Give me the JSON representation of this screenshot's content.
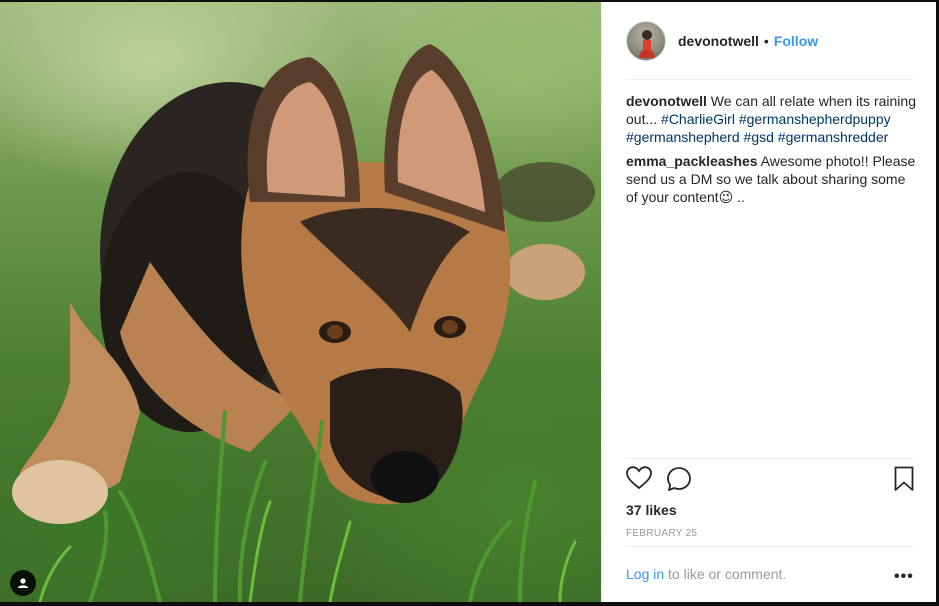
{
  "post": {
    "username": "devonotwell",
    "separator": "•",
    "follow_label": "Follow"
  },
  "comments": [
    {
      "user": "devonotwell",
      "text": "We can all relate when its raining out...",
      "tags": [
        "#CharlieGirl",
        "#germanshepherdpuppy",
        "#germanshepherd",
        "#gsd",
        "#germanshredder"
      ]
    },
    {
      "user": "emma_packleashes",
      "text": "Awesome photo!! Please send us a DM so we talk about sharing some of your content😉 .."
    }
  ],
  "likes_label": "37 likes",
  "date_label": "FEBRUARY 25",
  "footer": {
    "login_label": "Log in",
    "rest_text": " to like or comment.",
    "more_label": "•••"
  },
  "icons": {
    "like": "heart-icon",
    "comment": "comment-icon",
    "save": "bookmark-icon",
    "profile": "person-icon"
  }
}
